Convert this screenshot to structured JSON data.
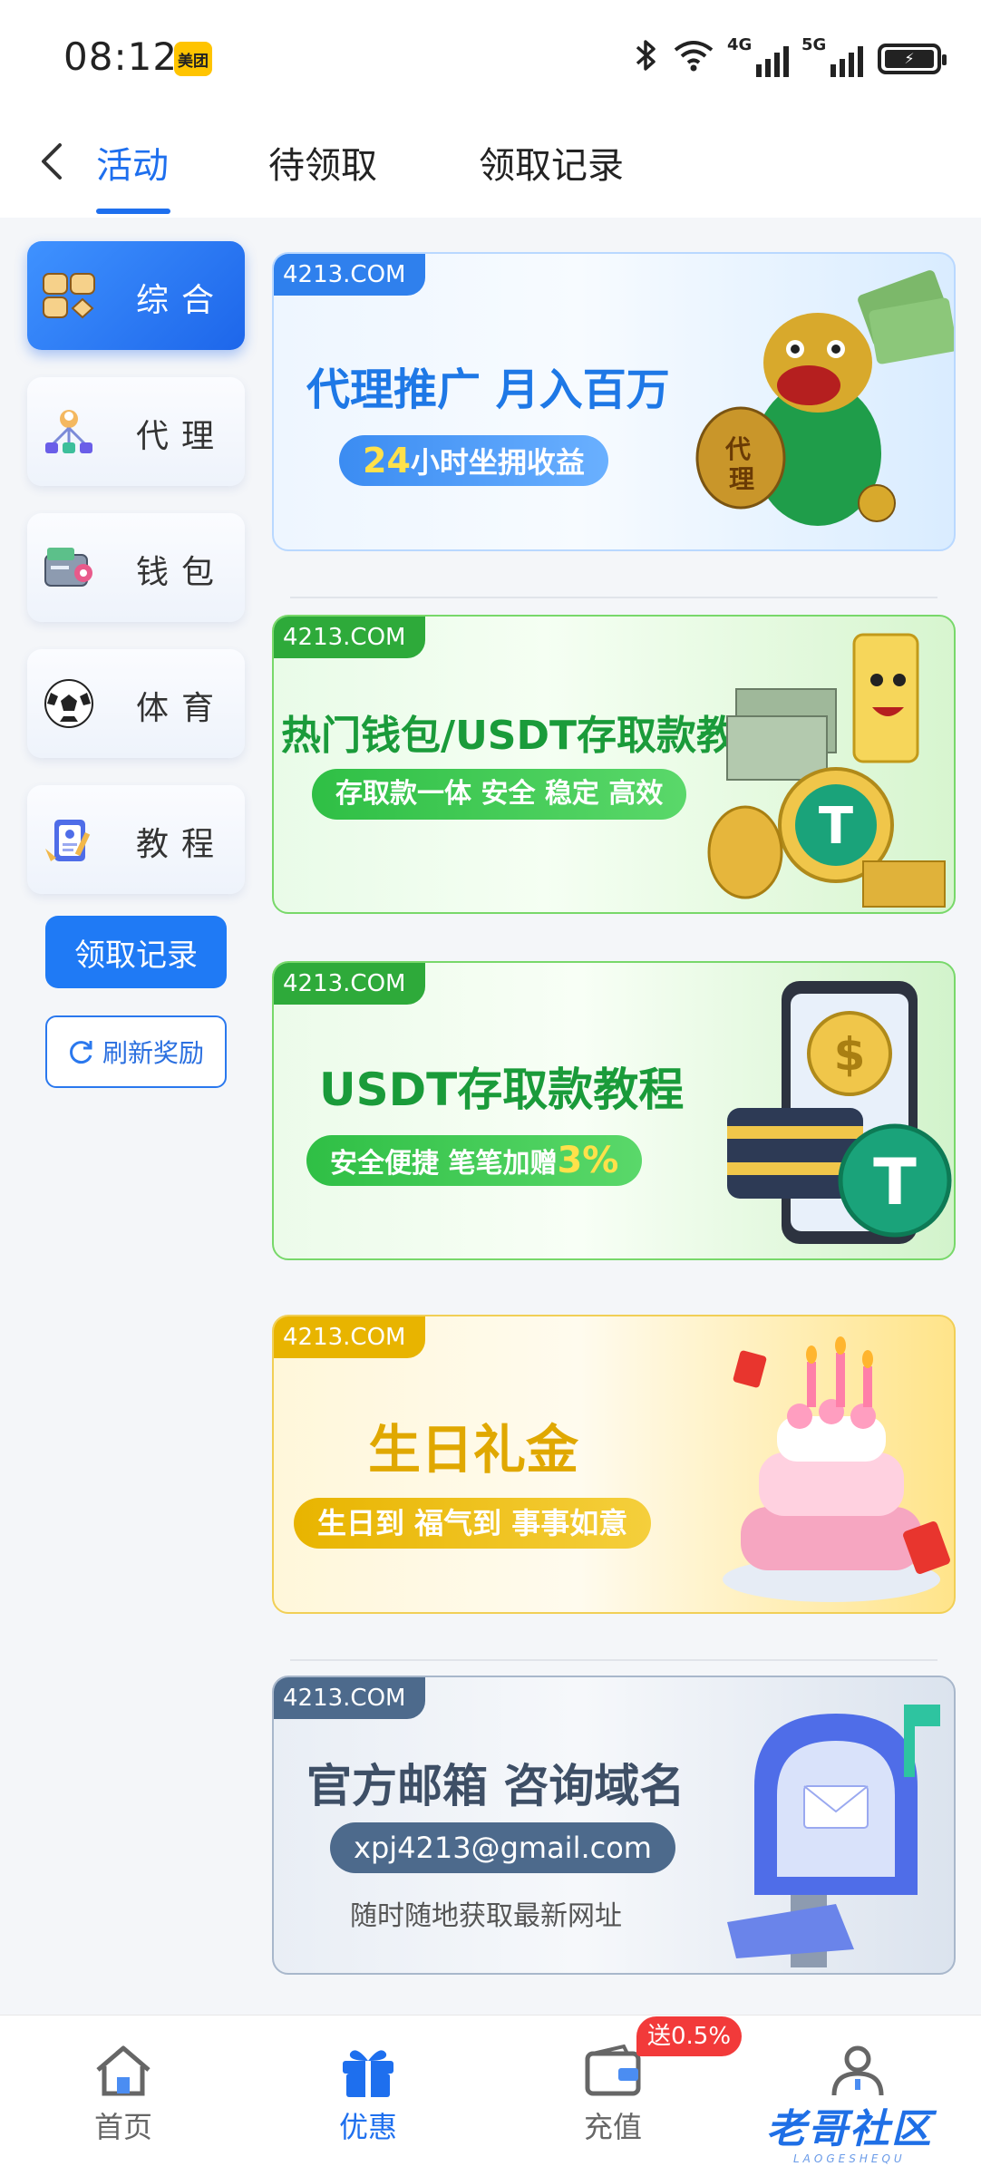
{
  "status_bar": {
    "time": "08:12",
    "app_badge": "美团",
    "network_4g": "4G",
    "network_5g": "5G"
  },
  "header": {
    "tabs": [
      {
        "label": "活动",
        "active": true
      },
      {
        "label": "待领取",
        "active": false
      },
      {
        "label": "领取记录",
        "active": false
      }
    ]
  },
  "sidebar": {
    "items": [
      {
        "label": "综合",
        "icon": "cards-icon",
        "active": true
      },
      {
        "label": "代理",
        "icon": "agent-network-icon",
        "active": false
      },
      {
        "label": "钱包",
        "icon": "wallet-icon",
        "active": false
      },
      {
        "label": "体育",
        "icon": "soccer-ball-icon",
        "active": false
      },
      {
        "label": "教程",
        "icon": "tutorial-clipboard-icon",
        "active": false
      }
    ],
    "record_button": "领取记录",
    "refresh_button": "刷新奖励"
  },
  "banners": [
    {
      "tag": "4213.COM",
      "title": "代理推广 月入百万",
      "pill_highlight": "24",
      "pill_text": "小时坐拥收益",
      "theme": "#2f80ed"
    },
    {
      "tag": "4213.COM",
      "title": "热门钱包/USDT存取款教程",
      "pill_text": "存取款一体 安全 稳定 高效",
      "theme": "#27ae3a"
    },
    {
      "tag": "4213.COM",
      "title": "USDT存取款教程",
      "pill_text": "安全便捷 笔笔加赠",
      "pill_highlight": "3%",
      "theme": "#27ae3a"
    },
    {
      "tag": "4213.COM",
      "title": "生日礼金",
      "pill_text": "生日到 福气到 事事如意",
      "theme": "#e8b400"
    },
    {
      "tag": "4213.COM",
      "title": "官方邮箱 咨询域名",
      "pill_text": "xpj4213@gmail.com",
      "subtitle": "随时随地获取最新网址",
      "theme": "#4d6a8c"
    }
  ],
  "bottom_nav": {
    "items": [
      {
        "label": "首页",
        "icon": "home-icon",
        "active": false
      },
      {
        "label": "优惠",
        "icon": "gift-icon",
        "active": true
      },
      {
        "label": "充值",
        "icon": "wallet-icon",
        "active": false
      },
      {
        "label": "",
        "icon": "profile-icon",
        "active": false
      }
    ],
    "badge": "送0.5%"
  },
  "watermark": {
    "text": "老哥社区",
    "subtext": "LAOGESHEQU"
  }
}
